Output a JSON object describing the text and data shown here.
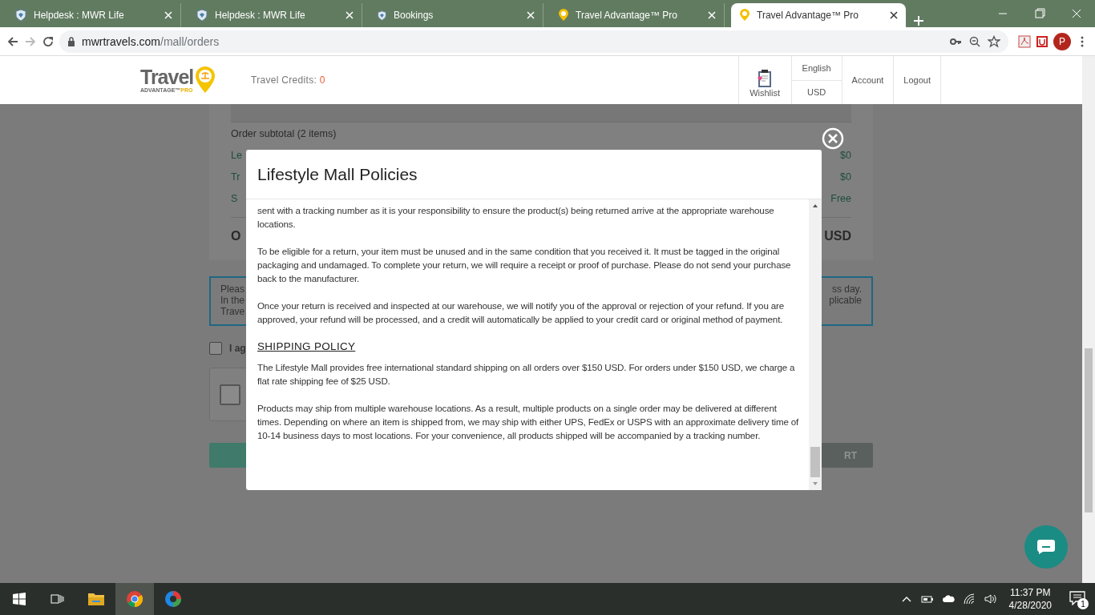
{
  "browser": {
    "tabs": [
      {
        "title": "Helpdesk : MWR Life",
        "kind": "shield",
        "selected": false
      },
      {
        "title": "Helpdesk : MWR Life",
        "kind": "shield",
        "selected": false
      },
      {
        "title": "Bookings",
        "kind": "shield-small",
        "selected": false
      },
      {
        "title": "Travel Advantage™ Pro",
        "kind": "pin",
        "selected": false
      },
      {
        "title": "Travel Advantage™ Pro",
        "kind": "pin",
        "selected": true
      }
    ],
    "url_host": "mwrtravels.com",
    "url_path": "/mall/orders",
    "profile_initial": "P"
  },
  "header": {
    "logo_word": "Travel",
    "logo_sub": "ADVANTAGE™",
    "logo_pro": "PRO",
    "credits_label": "Travel Credits:",
    "credits_value": "0",
    "wishlist": "Wishlist",
    "language": "English",
    "currency": "USD",
    "nav": [
      "Account",
      "Logout"
    ]
  },
  "order": {
    "rows": [
      {
        "left": "Order subtotal (2 items)",
        "right": "",
        "kind": "plain"
      },
      {
        "left": "Le",
        "right": "$0",
        "kind": "green"
      },
      {
        "left": "Tr",
        "right": "$0",
        "kind": "green"
      },
      {
        "left": "S",
        "right": "Free",
        "kind": "green"
      }
    ],
    "total": {
      "left": "O",
      "right": "USD"
    }
  },
  "notice": {
    "left_lines": [
      "Pleas",
      "In the",
      "Trave"
    ],
    "right_lines": [
      "ss day.",
      "plicable"
    ]
  },
  "agree_checkbox": {
    "label": "I ag",
    "checked": false
  },
  "captcha_checkbox": {
    "checked": false
  },
  "submit_button": {
    "label": "RT"
  },
  "modal": {
    "title": "Lifestyle Mall Policies",
    "blocks": [
      {
        "kind": "p",
        "text": "sent with a tracking number as it is your responsibility to ensure the product(s) being returned arrive at the appropriate warehouse locations."
      },
      {
        "kind": "p",
        "text": "To be eligible for a return, your item must be unused and in the same condition that you received it. It must be tagged in the original packaging and undamaged. To complete your return, we will require a receipt or proof of purchase. Please do not send your purchase back to the manufacturer."
      },
      {
        "kind": "p",
        "text": "Once your return is received and inspected at our warehouse, we will notify you of the approval or rejection of your refund. If you are approved, your refund will be processed, and a credit will automatically be applied to your credit card or original method of payment."
      },
      {
        "kind": "heading",
        "text": "SHIPPING POLICY"
      },
      {
        "kind": "p",
        "text": "The Lifestyle Mall provides free international standard shipping on all orders over $150 USD. For orders under $150 USD, we charge a flat rate shipping fee of $25 USD."
      },
      {
        "kind": "p",
        "text": "Products may ship from multiple warehouse locations. As a result, multiple products on a single order may be delivered at different times. Depending on where an item is shipped from, we may ship with either UPS, FedEx or USPS with an approximate delivery time of 10-14 business days to most locations. For your convenience, all products shipped will be accompanied by a tracking number."
      }
    ]
  },
  "taskbar": {
    "time": "11:37 PM",
    "date": "4/28/2020",
    "notifications": "1"
  }
}
